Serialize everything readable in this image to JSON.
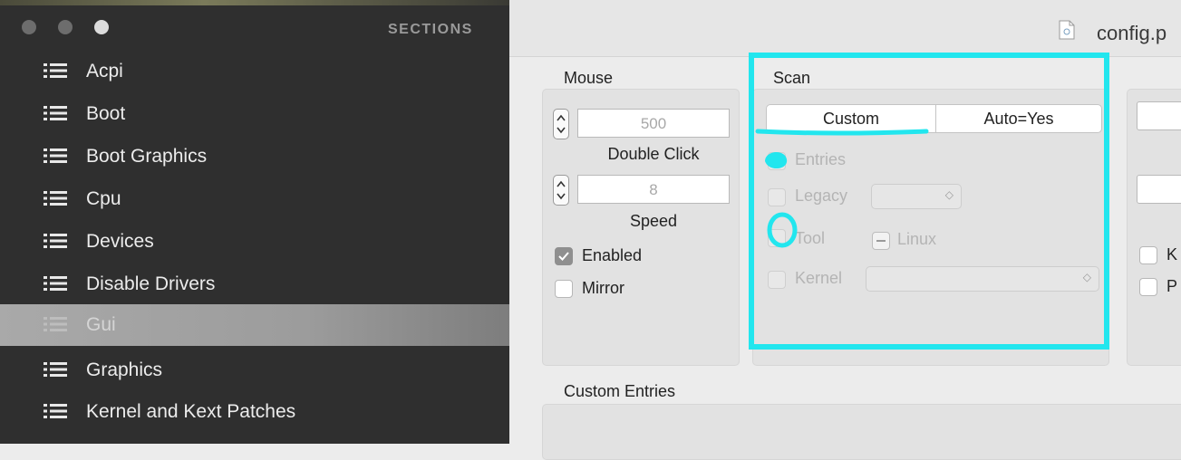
{
  "sidebar": {
    "title": "SECTIONS",
    "items": [
      {
        "label": "Acpi",
        "selected": false
      },
      {
        "label": "Boot",
        "selected": false
      },
      {
        "label": "Boot Graphics",
        "selected": false
      },
      {
        "label": "Cpu",
        "selected": false
      },
      {
        "label": "Devices",
        "selected": false
      },
      {
        "label": "Disable Drivers",
        "selected": false
      },
      {
        "label": "Gui",
        "selected": true
      },
      {
        "label": "Graphics",
        "selected": false
      },
      {
        "label": "Kernel and Kext Patches",
        "selected": false
      }
    ]
  },
  "window": {
    "title": "config.p"
  },
  "mouse": {
    "label": "Mouse",
    "double_click_value": "500",
    "double_click_label": "Double Click",
    "speed_value": "8",
    "speed_label": "Speed",
    "enabled_label": "Enabled",
    "enabled_checked": true,
    "mirror_label": "Mirror",
    "mirror_checked": false
  },
  "scan": {
    "label": "Scan",
    "segments": [
      "Custom",
      "Auto=Yes"
    ],
    "selected_segment": "Custom",
    "entries_label": "Entries",
    "legacy_label": "Legacy",
    "tool_label": "Tool",
    "linux_label": "Linux",
    "kernel_label": "Kernel"
  },
  "right_panel": {
    "k_label": "K",
    "p_label": "P"
  },
  "custom_entries": {
    "label": "Custom Entries"
  },
  "colors": {
    "sidebar_bg": "#2f2f2f",
    "annotation": "#22e6ee",
    "selected_row": "#a9a9a9"
  },
  "icons": [
    "list-icon",
    "document-icon",
    "stepper-icon",
    "checkmark-icon",
    "chevron-updown-icon",
    "minus-icon"
  ]
}
